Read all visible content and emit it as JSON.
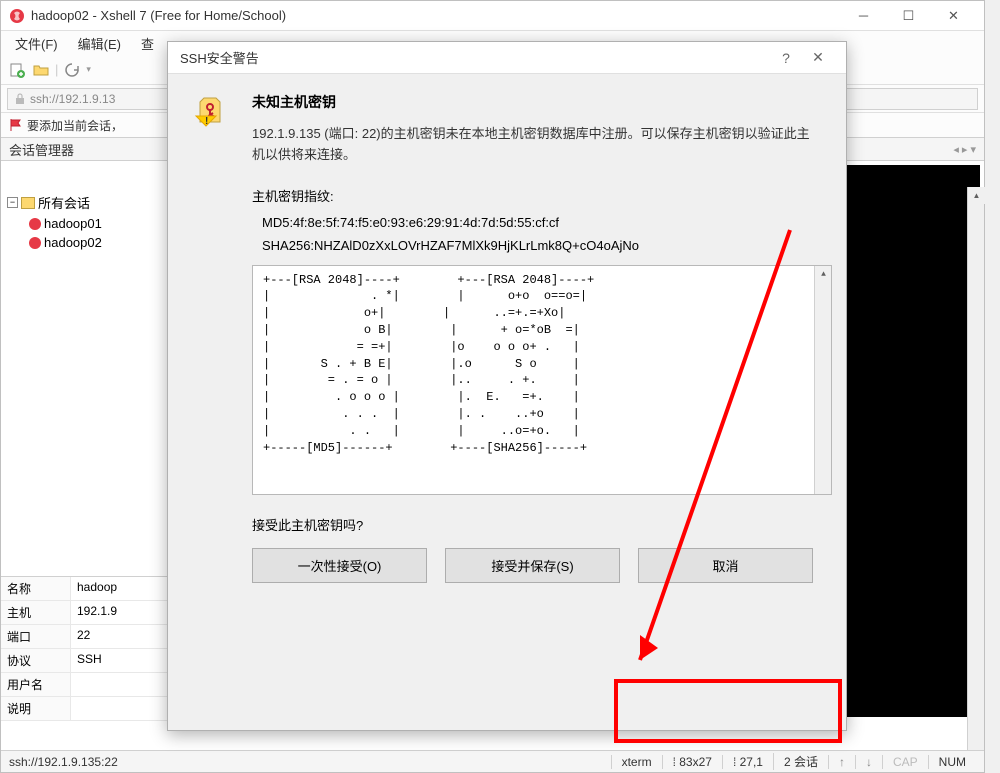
{
  "window": {
    "title": "hadoop02 - Xshell 7 (Free for Home/School)"
  },
  "menu": {
    "file": "文件(F)",
    "edit": "编辑(E)",
    "view": "查"
  },
  "addressbar": {
    "url": "ssh://192.1.9.13"
  },
  "tipbar": {
    "text": "要添加当前会话，"
  },
  "sessionManager": {
    "title": "会话管理器",
    "root": "所有会话",
    "items": [
      "hadoop01",
      "hadoop02"
    ]
  },
  "properties": {
    "labels": {
      "name": "名称",
      "host": "主机",
      "port": "端口",
      "protocol": "协议",
      "user": "用户名",
      "desc": "说明"
    },
    "values": {
      "name": "hadoop",
      "host": "192.1.9",
      "port": "22",
      "protocol": "SSH",
      "user": "",
      "desc": ""
    }
  },
  "dialog": {
    "title": "SSH安全警告",
    "heading": "未知主机密钥",
    "description": "192.1.9.135 (端口: 22)的主机密钥未在本地主机密钥数据库中注册。可以保存主机密钥以验证此主机以供将来连接。",
    "fingerprintLabel": "主机密钥指纹:",
    "md5": "MD5:4f:8e:5f:74:f5:e0:93:e6:29:91:4d:7d:5d:55:cf:cf",
    "sha256": "SHA256:NHZAlD0zXxLOVrHZAF7MlXk9HjKLrLmk8Q+cO4oAjNo",
    "randomart": "+---[RSA 2048]----+        +---[RSA 2048]----+\n|              . *|        |      o+o  o==o=|\n|             o+|        |      ..=+.=+Xo|\n|             o B|        |      + o=*oB  =|\n|            = =+|        |o    o o o+ .   |\n|       S . + B E|        |.o      S o     |\n|        = . = o |        |..     . +.     |\n|         . o o o |        |.  E.   =+.    |\n|          . . .  |        |. .    ..+o    |\n|           . .   |        |     ..o=+o.   |\n+-----[MD5]------+        +----[SHA256]-----+",
    "acceptQuestion": "接受此主机密钥吗?",
    "buttons": {
      "once": "一次性接受(O)",
      "save": "接受并保存(S)",
      "cancel": "取消"
    }
  },
  "statusbar": {
    "left": "ssh://192.1.9.135:22",
    "term": "xterm",
    "size": "83x27",
    "pos": "27,1",
    "sessions": "2 会话",
    "cap": "CAP",
    "num": "NUM"
  }
}
